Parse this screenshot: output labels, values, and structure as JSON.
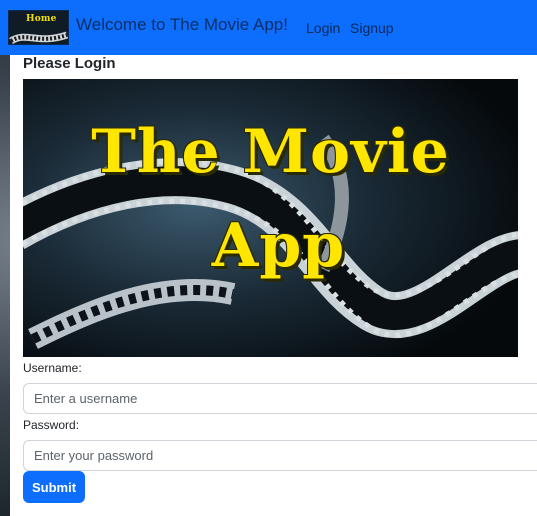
{
  "navbar": {
    "logo_text": "Home",
    "title": "Welcome to The Movie App!",
    "login_label": "Login",
    "signup_label": "Signup"
  },
  "login": {
    "heading": "Please Login",
    "hero_line1": "The Movie",
    "hero_line2": "App",
    "username_label": "Username:",
    "username_placeholder": "Enter a username",
    "password_label": "Password:",
    "password_placeholder": "Enter your password",
    "submit_label": "Submit"
  },
  "colors": {
    "navbar": "#0d6efd",
    "button": "#0d6efd",
    "title_yellow": "#ffe600"
  }
}
